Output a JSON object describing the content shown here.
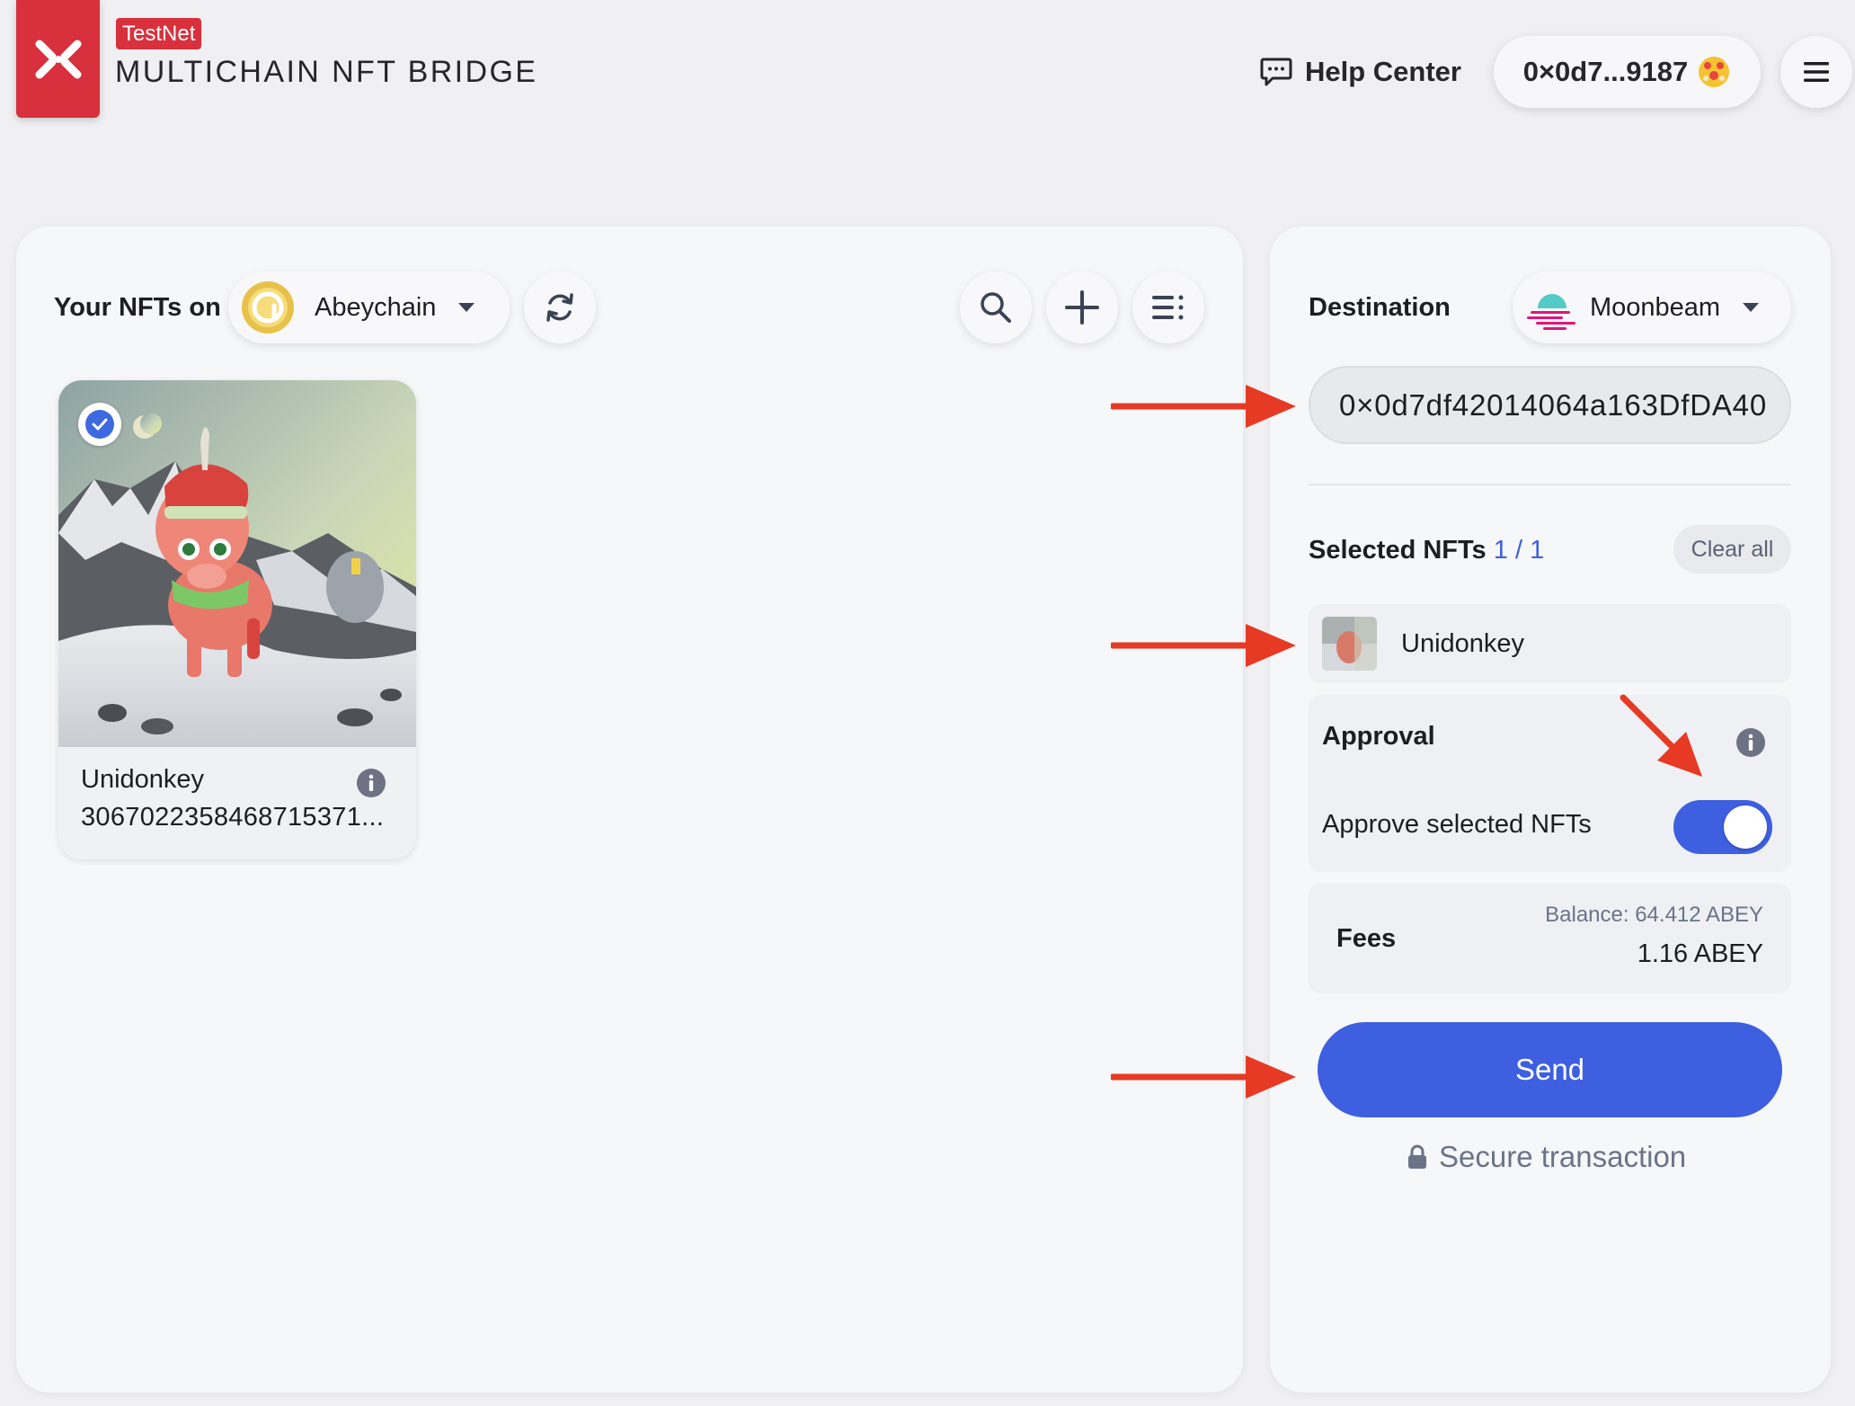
{
  "header": {
    "badge": "TestNet",
    "brand_title": "MULTICHAIN NFT BRIDGE",
    "help_label": "Help Center",
    "wallet_address": "0×0d7...9187",
    "accent_color": "#d8303d"
  },
  "source": {
    "label": "Your NFTs on",
    "chain": "Abeychain",
    "tool_icons": [
      "refresh-icon",
      "search-icon",
      "plus-icon",
      "list-filter-icon"
    ]
  },
  "nfts": [
    {
      "name": "Unidonkey",
      "token_id": "3067022358468715371...",
      "selected": true
    }
  ],
  "destination": {
    "label": "Destination",
    "chain": "Moonbeam",
    "address": "0×0d7df42014064a163DfDA40"
  },
  "selection": {
    "label": "Selected NFTs",
    "count": "1 / 1",
    "clear_label": "Clear all",
    "items": [
      {
        "name": "Unidonkey"
      }
    ]
  },
  "approval": {
    "title": "Approval",
    "toggle_label": "Approve selected NFTs",
    "enabled": true
  },
  "fees": {
    "label": "Fees",
    "balance": "Balance: 64.412 ABEY",
    "amount": "1.16 ABEY"
  },
  "actions": {
    "send_label": "Send",
    "secure_label": "Secure transaction",
    "primary_color": "#3d5fe0"
  },
  "annotation_color": "#e63a24"
}
